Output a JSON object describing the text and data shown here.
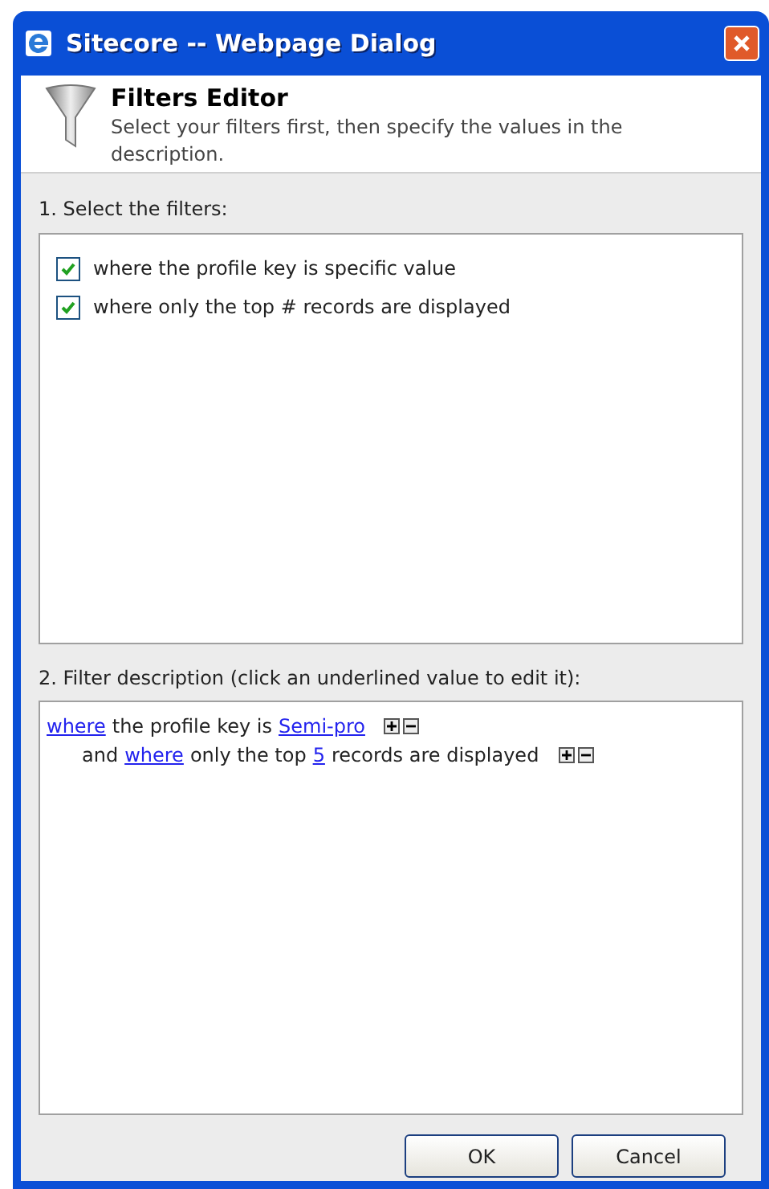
{
  "window": {
    "title": "Sitecore -- Webpage Dialog"
  },
  "header": {
    "title": "Filters Editor",
    "description": "Select your filters first, then specify the values in the description."
  },
  "filters": {
    "label": "1. Select the filters:",
    "items": [
      {
        "label": "where the profile key is specific value",
        "checked": true
      },
      {
        "label": "where only the top # records are displayed",
        "checked": true
      }
    ]
  },
  "description": {
    "label": "2. Filter description (click an underlined value to edit it):",
    "lines": [
      {
        "indented": false,
        "parts": [
          {
            "kind": "link",
            "text": "where"
          },
          {
            "kind": "text",
            "text": "the profile key is"
          },
          {
            "kind": "link",
            "text": "Semi-pro"
          }
        ]
      },
      {
        "indented": true,
        "parts": [
          {
            "kind": "text",
            "text": "and"
          },
          {
            "kind": "link",
            "text": "where"
          },
          {
            "kind": "text",
            "text": "only the top"
          },
          {
            "kind": "link",
            "text": "5"
          },
          {
            "kind": "text",
            "text": "records are displayed"
          }
        ]
      }
    ]
  },
  "buttons": [
    "OK",
    "Cancel"
  ]
}
